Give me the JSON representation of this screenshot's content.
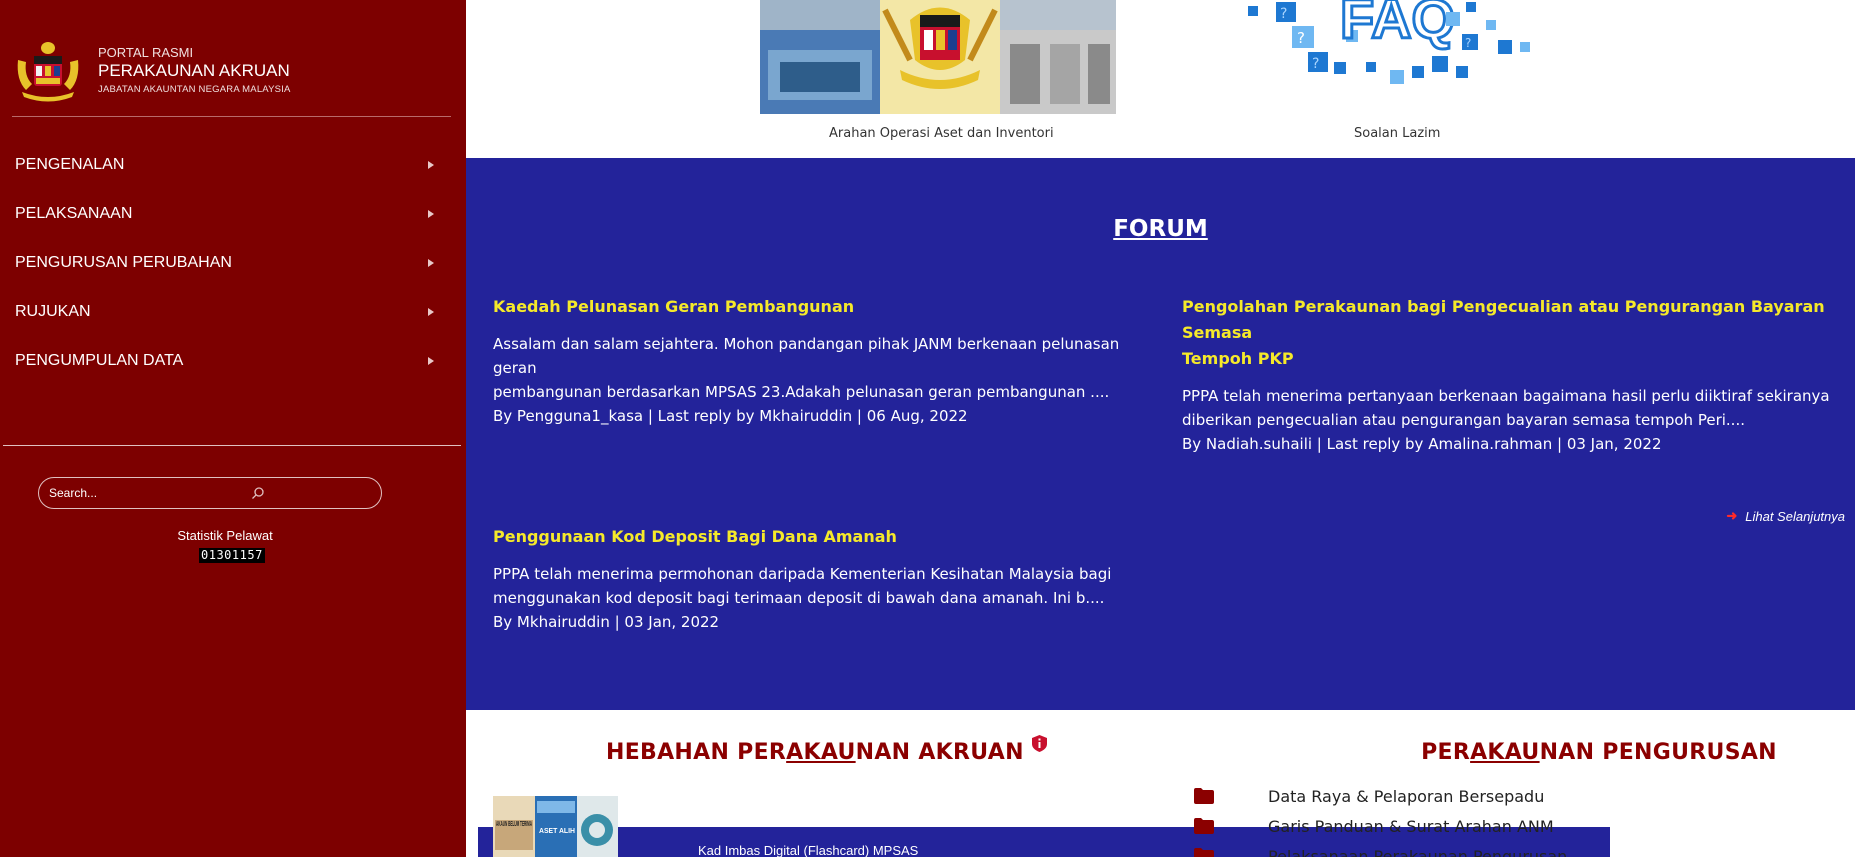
{
  "brand": {
    "line1": "PORTAL RASMI",
    "line2": "PERAKAUNAN AKRUAN",
    "line3": "JABATAN AKAUNTAN NEGARA MALAYSIA"
  },
  "menu": [
    {
      "label": "PENGENALAN",
      "icon": "arrow-right-icon"
    },
    {
      "label": "PELAKSANAAN",
      "icon": "arrow-right-icon"
    },
    {
      "label": "PENGURUSAN PERUBAHAN",
      "icon": "arrow-right-icon"
    },
    {
      "label": "RUJUKAN",
      "icon": "arrow-right-icon"
    },
    {
      "label": "PENGUMPULAN DATA",
      "icon": "arrow-right-icon"
    }
  ],
  "search": {
    "placeholder": "Search..."
  },
  "stats": {
    "label": "Statistik Pelawat",
    "count": "01301157"
  },
  "thumbs": {
    "caption1": "Arahan Operasi Aset dan Inventori",
    "caption2": "Soalan Lazim",
    "faq_text": "FAQ"
  },
  "forum": {
    "title": "FORUM",
    "more": "Lihat Selanjutnya",
    "posts": [
      {
        "title": "Kaedah Pelunasan Geran Pembangunan",
        "excerpt_1": "Assalam dan salam sejahtera. Mohon pandangan pihak JANM berkenaan pelunasan geran",
        "excerpt_2": "pembangunan berdasarkan MPSAS 23.Adakah pelunasan geran pembangunan ....",
        "meta": "By Pengguna1_kasa | Last reply by Mkhairuddin | 06 Aug, 2022"
      },
      {
        "title_1": "Pengolahan Perakaunan bagi Pengecualian atau Pengurangan Bayaran Semasa",
        "title_2": "Tempoh PKP",
        "excerpt_1": "PPPA telah menerima pertanyaan berkenaan bagaimana hasil perlu diiktiraf sekiranya",
        "excerpt_2": "diberikan pengecualian atau pengurangan bayaran semasa tempoh Peri....",
        "meta": "By Nadiah.suhaili | Last reply by Amalina.rahman | 03 Jan, 2022"
      },
      {
        "title": "Penggunaan Kod Deposit Bagi Dana Amanah",
        "excerpt_1": "PPPA telah menerima permohonan daripada Kementerian Kesihatan Malaysia bagi",
        "excerpt_2": "menggunakan kod deposit bagi terimaan deposit di bawah dana amanah. Ini b....",
        "meta": "By Mkhairuddin | 03 Jan, 2022"
      }
    ]
  },
  "hebahan": {
    "title_a": "HEBAHAN PER",
    "title_b": "AKAU",
    "title_c": "NAN AKRUAN",
    "bar_text": "Kad Imbas Digital (Flashcard) MPSAS",
    "book1": "AKAUN BELUM TERIMA",
    "book2": "ASET ALIH"
  },
  "pengurusan": {
    "title_a": "PER",
    "title_b": "AKAU",
    "title_c": "NAN PENGURUSAN",
    "items": [
      {
        "label": "Data Raya & Pelaporan Bersepadu",
        "icon": "folder-icon"
      },
      {
        "label": "Garis Panduan & Surat Arahan ANM",
        "icon": "folder-icon"
      },
      {
        "label": "Pelaksanaan Perakaunan Pengurusan",
        "icon": "folder-icon"
      }
    ]
  },
  "colors": {
    "sidebar": "#7d0000",
    "forum_bg": "#23239a",
    "forum_title": "#f5e92a",
    "heading_red": "#8b0000"
  }
}
